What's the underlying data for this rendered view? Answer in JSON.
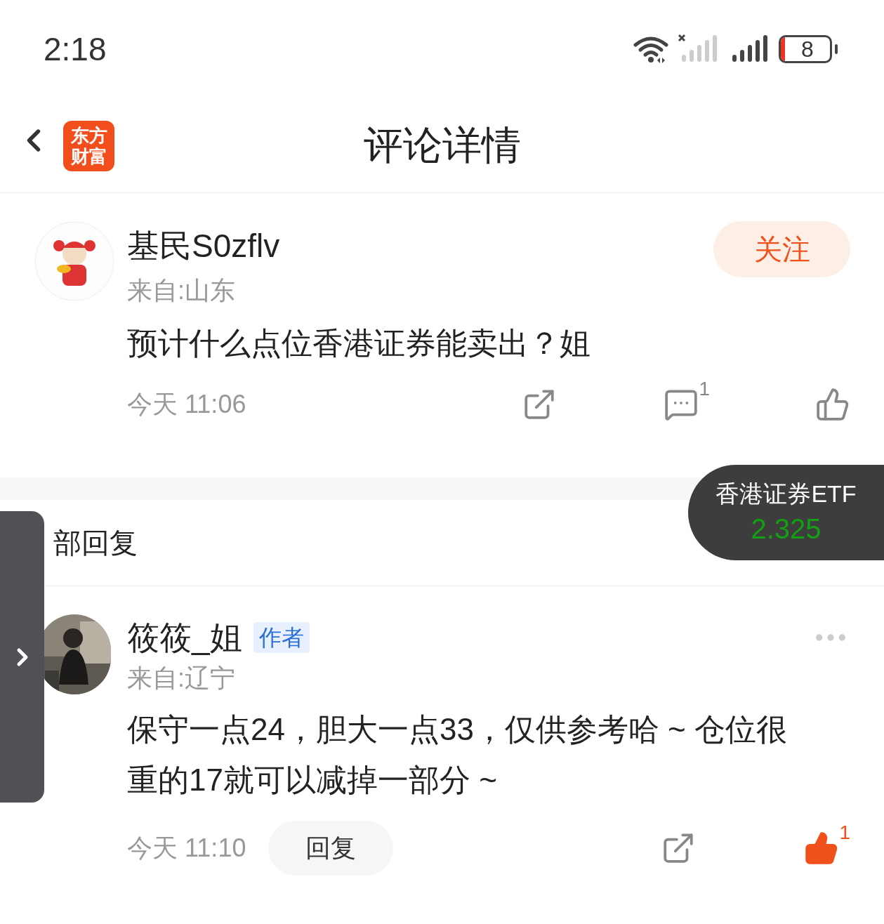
{
  "status_bar": {
    "time": "2:18",
    "battery": "8"
  },
  "header": {
    "logo_lines": [
      "东方",
      "财富"
    ],
    "title": "评论详情"
  },
  "post": {
    "author": "基民S0zflv",
    "location": "来自:山东",
    "follow": "关注",
    "content": "预计什么点位香港证券能卖出？姐",
    "time": "今天 11:06",
    "comment_count": "1",
    "liked": false
  },
  "replies_header": {
    "title": "部回复"
  },
  "ticker": {
    "name": "香港证券ETF",
    "price": "2.325",
    "color": "#12a012"
  },
  "replies": [
    {
      "author": "筱筱_姐",
      "badge": "作者",
      "location": "来自:辽宁",
      "content": "保守一点24，胆大一点33，仅供参考哈 ~ 仓位很重的17就可以减掉一部分 ~",
      "time": "今天 11:10",
      "reply": "回复",
      "like_count": "1",
      "liked": true
    }
  ]
}
